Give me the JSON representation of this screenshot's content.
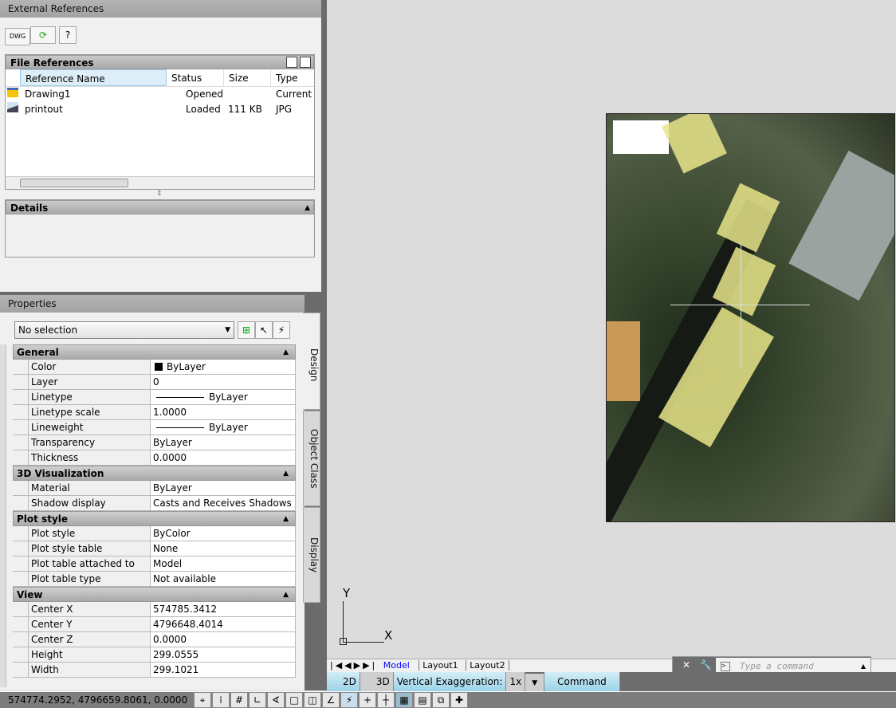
{
  "xref": {
    "title": "External References",
    "toolbar": {
      "attach": "DWG",
      "refresh": "⟳",
      "help": "?"
    },
    "file_refs": {
      "title": "File References",
      "columns": [
        "Reference Name",
        "Status",
        "Size",
        "Type"
      ],
      "rows": [
        {
          "name": "Drawing1",
          "status": "Opened",
          "size": "",
          "type": "Current",
          "icon": "drawing-icon"
        },
        {
          "name": "printout",
          "status": "Loaded",
          "size": "111 KB",
          "type": "JPG",
          "icon": "image-icon"
        }
      ]
    },
    "details": {
      "title": "Details"
    }
  },
  "properties": {
    "title": "Properties",
    "selection": "No selection",
    "tabs": [
      "Design",
      "Object Class",
      "Display"
    ],
    "sections": [
      {
        "title": "General",
        "rows": [
          [
            "Color",
            "ByLayer"
          ],
          [
            "Layer",
            "0"
          ],
          [
            "Linetype",
            "ByLayer"
          ],
          [
            "Linetype scale",
            "1.0000"
          ],
          [
            "Lineweight",
            "ByLayer"
          ],
          [
            "Transparency",
            "ByLayer"
          ],
          [
            "Thickness",
            "0.0000"
          ]
        ]
      },
      {
        "title": "3D Visualization",
        "rows": [
          [
            "Material",
            "ByLayer"
          ],
          [
            "Shadow display",
            "Casts and Receives Shadows"
          ]
        ]
      },
      {
        "title": "Plot style",
        "rows": [
          [
            "Plot style",
            "ByColor"
          ],
          [
            "Plot style table",
            "None"
          ],
          [
            "Plot table attached to",
            "Model"
          ],
          [
            "Plot table type",
            "Not available"
          ]
        ]
      },
      {
        "title": "View",
        "rows": [
          [
            "Center X",
            "574785.3412"
          ],
          [
            "Center Y",
            "4796648.4014"
          ],
          [
            "Center Z",
            "0.0000"
          ],
          [
            "Height",
            "299.0555"
          ],
          [
            "Width",
            "299.1021"
          ]
        ]
      }
    ]
  },
  "ucs": {
    "x": "X",
    "y": "Y"
  },
  "layout_tabs": [
    "Model",
    "Layout1",
    "Layout2"
  ],
  "command": {
    "placeholder": "Type a command"
  },
  "viewbar": {
    "b2d": "2D",
    "b3d": "3D",
    "vert": "Vertical Exaggeration:",
    "scale": "1x",
    "command": "Command"
  },
  "status": {
    "coords": "574774.2952, 4796659.8061, 0.0000"
  },
  "colors": {
    "accent": "#9bd2e6",
    "model_tab": "#0000ff",
    "building": "#e8e58a"
  }
}
